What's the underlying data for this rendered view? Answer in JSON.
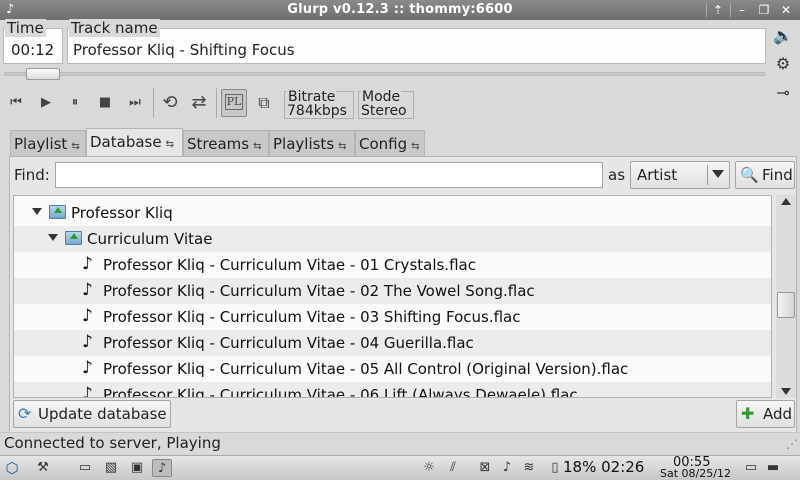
{
  "window": {
    "title": "Glurp v0.12.3 :: thommy:6600"
  },
  "info": {
    "time_label": "Time",
    "time_value": "00:12",
    "track_label": "Track name",
    "track_value": "Professor Kliq - Shifting Focus",
    "seek_fraction": 0.03
  },
  "player": {
    "bitrate_label": "Bitrate",
    "bitrate_value": "784kbps",
    "mode_label": "Mode",
    "mode_value": "Stereo",
    "pl_label": "PL"
  },
  "tabs": [
    {
      "label": "Playlist",
      "active": false
    },
    {
      "label": "Database",
      "active": true
    },
    {
      "label": "Streams",
      "active": false
    },
    {
      "label": "Playlists",
      "active": false
    },
    {
      "label": "Config",
      "active": false
    }
  ],
  "search": {
    "find_label": "Find:",
    "find_value": "",
    "as_label": "as",
    "field_selected": "Artist",
    "find_button": "Find"
  },
  "tree": {
    "rows": [
      {
        "label": "Professor Kliq",
        "type": "folder",
        "depth": 0
      },
      {
        "label": "Curriculum Vitae",
        "type": "folder",
        "depth": 1
      },
      {
        "label": "Professor Kliq - Curriculum Vitae - 01 Crystals.flac",
        "type": "file",
        "depth": 2
      },
      {
        "label": "Professor Kliq - Curriculum Vitae - 02 The Vowel Song.flac",
        "type": "file",
        "depth": 2
      },
      {
        "label": "Professor Kliq - Curriculum Vitae - 03 Shifting Focus.flac",
        "type": "file",
        "depth": 2
      },
      {
        "label": "Professor Kliq - Curriculum Vitae - 04 Guerilla.flac",
        "type": "file",
        "depth": 2
      },
      {
        "label": "Professor Kliq - Curriculum Vitae - 05 All Control (Original Version).flac",
        "type": "file",
        "depth": 2
      },
      {
        "label": "Professor Kliq - Curriculum Vitae - 06 Lift (Always Dewaele).flac",
        "type": "file",
        "depth": 2
      }
    ]
  },
  "actions": {
    "update_label": "Update database",
    "add_label": "Add"
  },
  "status": {
    "text": "Connected to server, Playing"
  },
  "taskbar": {
    "battery": "18% 02:26",
    "clock_time": "00:55",
    "clock_date": "Sat 08/25/12"
  }
}
